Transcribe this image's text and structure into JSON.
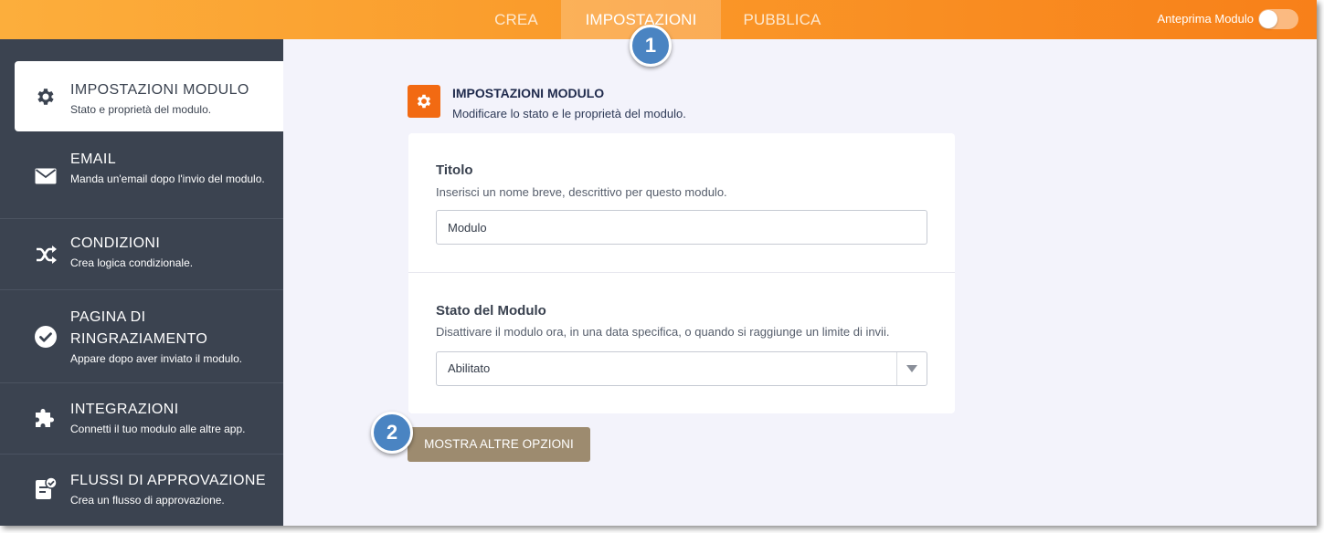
{
  "topbar": {
    "tabs": [
      {
        "label": "CREA",
        "active": false
      },
      {
        "label": "IMPOSTAZIONI",
        "active": true
      },
      {
        "label": "PUBBLICA",
        "active": false
      }
    ],
    "preview_label": "Anteprima Modulo",
    "preview_enabled": false
  },
  "sidebar": {
    "items": [
      {
        "title": "IMPOSTAZIONI MODULO",
        "subtitle": "Stato e proprietà del modulo.",
        "icon": "gear-icon",
        "active": true
      },
      {
        "title": "EMAIL",
        "subtitle": "Manda un'email dopo l'invio del modulo.",
        "icon": "envelope-icon",
        "active": false
      },
      {
        "title": "CONDIZIONI",
        "subtitle": "Crea logica condizionale.",
        "icon": "shuffle-icon",
        "active": false
      },
      {
        "title": "PAGINA DI RINGRAZIAMENTO",
        "subtitle": "Appare dopo aver inviato il modulo.",
        "icon": "check-circle-icon",
        "active": false
      },
      {
        "title": "INTEGRAZIONI",
        "subtitle": "Connetti il tuo modulo alle altre app.",
        "icon": "puzzle-icon",
        "active": false
      },
      {
        "title": "FLUSSI DI APPROVAZIONE",
        "subtitle": "Crea un flusso di approvazione.",
        "icon": "approval-icon",
        "active": false
      }
    ]
  },
  "main": {
    "section_title": "IMPOSTAZIONI MODULO",
    "section_subtitle": "Modificare lo stato e le proprietà del modulo.",
    "title_field": {
      "label": "Titolo",
      "hint": "Inserisci un nome breve, descrittivo per questo modulo.",
      "value": "Modulo"
    },
    "status_field": {
      "label": "Stato del Modulo",
      "hint": "Disattivare il modulo ora, in una data specifica, o quando si raggiunge un limite di invii.",
      "value": "Abilitato"
    },
    "more_options_label": "MOSTRA ALTRE OPZIONI"
  },
  "callouts": [
    "1",
    "2"
  ],
  "colors": {
    "accent": "#f88019",
    "sidebar_bg": "#3b4350",
    "section_icon_bg": "#f26a12",
    "button_bg": "#9d8b6f",
    "callout_bg": "#4a84c2"
  }
}
